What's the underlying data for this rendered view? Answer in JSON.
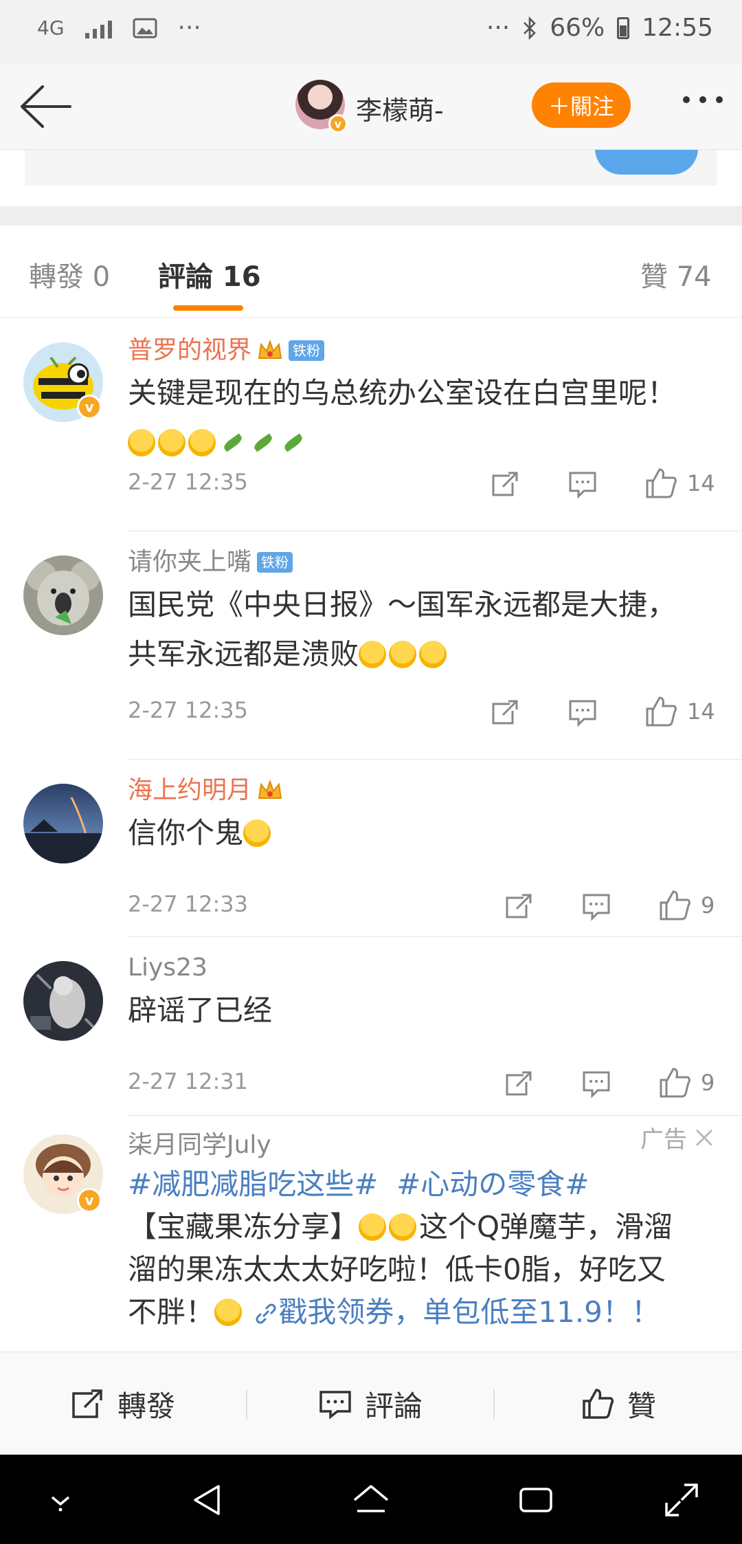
{
  "status_bar": {
    "network": "4G",
    "more": "···",
    "more_right": "···",
    "battery": "66%",
    "time": "12:55"
  },
  "header": {
    "title": "李檬萌-",
    "follow_label": "＋關注"
  },
  "remnant_text": "         ",
  "tabs": [
    {
      "label": "轉發 0"
    },
    {
      "label": "評論 16"
    },
    {
      "label": "贊 74"
    }
  ],
  "comments": [
    {
      "name": "普罗的视界",
      "fan_badge": "铁粉",
      "text": "关键是现在的乌总统办公室设在白宫里呢！",
      "time": "2-27 12:35",
      "likes": "14"
    },
    {
      "name": "请你夹上嘴",
      "fan_badge": "铁粉",
      "text_line1": "国民党《中央日报》～国军永远都是大捷，",
      "text_line2": "共军永远都是溃败",
      "time": "2-27 12:35",
      "likes": "14"
    },
    {
      "name": "海上约明月",
      "text": "信你个鬼",
      "time": "2-27 12:33",
      "likes": "9"
    },
    {
      "name": "Liys23",
      "text": "辟谣了已经",
      "time": "2-27 12:31",
      "likes": "9"
    }
  ],
  "ad": {
    "name": "柒月同学July",
    "tag": "广告",
    "topic1": "#减肥减脂吃这些#",
    "topic2": "#心动の零食#",
    "text_a": "【宝藏果冻分享】",
    "text_b": "这个Q弹魔芋，滑溜",
    "text_c": "溜的果冻太太太好吃啦！低卡0脂，好吃又",
    "text_d": "不胖！",
    "link": "戳我领券，单包低至11.9！！"
  },
  "action_bar": {
    "repost": "轉發",
    "comment": "評論",
    "like": "贊"
  },
  "colors": {
    "accent": "#ff8200",
    "vip_name": "#eb7350",
    "link": "#4a7fc1"
  }
}
